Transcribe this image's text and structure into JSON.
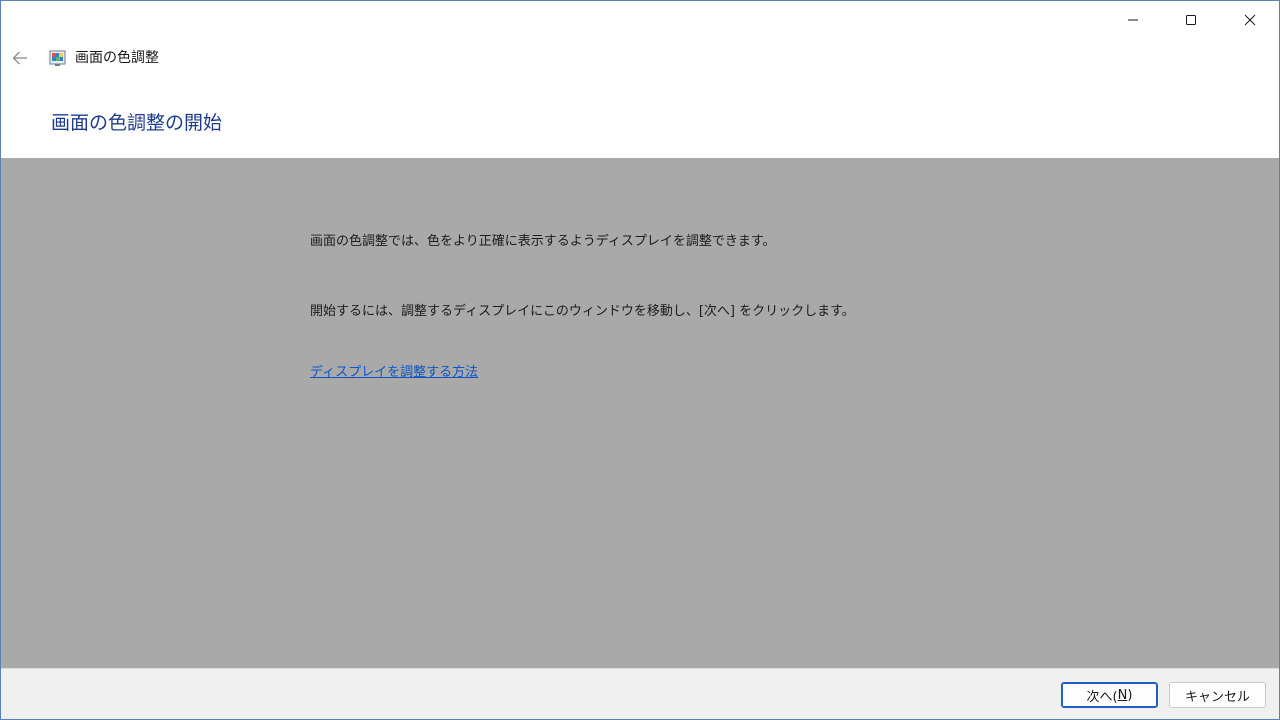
{
  "window": {
    "title": "画面の色調整",
    "controls": {
      "minimize_icon": "minimize-icon",
      "maximize_icon": "maximize-icon",
      "close_icon": "close-icon"
    }
  },
  "nav": {
    "back_icon": "arrow-left-icon"
  },
  "page": {
    "heading": "画面の色調整の開始"
  },
  "content": {
    "paragraph_1": "画面の色調整では、色をより正確に表示するようディスプレイを調整できます。",
    "paragraph_2": "開始するには、調整するディスプレイにこのウィンドウを移動し、[次へ] をクリックします。",
    "help_link": "ディスプレイを調整する方法"
  },
  "footer": {
    "next_label_prefix": "次へ(",
    "next_label_mnemonic": "N",
    "next_label_suffix": ")",
    "cancel_label": "キャンセル"
  },
  "colors": {
    "heading": "#1e3c8c",
    "link": "#0b56c5",
    "content_bg": "#a9a9a9",
    "footer_bg": "#f0f0f0",
    "primary_border": "#1f5fbf"
  }
}
